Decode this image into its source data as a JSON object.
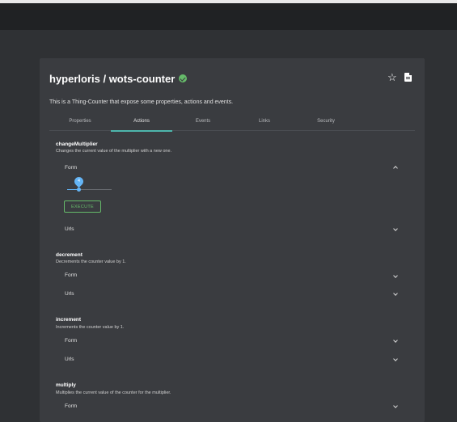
{
  "header": {
    "title": "hyperloris / wots-counter",
    "verified_icon": "check-circle-icon",
    "star_icon": "star-outline-icon",
    "doc_icon": "document-icon"
  },
  "description": "This is a Thing-Counter that expose some properties, actions and events.",
  "tabs": [
    {
      "label": "Properties",
      "active": false
    },
    {
      "label": "Actions",
      "active": true
    },
    {
      "label": "Events",
      "active": false
    },
    {
      "label": "Links",
      "active": false
    },
    {
      "label": "Security",
      "active": false
    }
  ],
  "actions": [
    {
      "name": "changeMultiplier",
      "description": "Changes the current value of the multiplier with a new one.",
      "form_label": "Form",
      "urls_label": "Urls",
      "slider_value": "4",
      "slider_fraction": 0.25,
      "execute_label": "EXECUTE"
    },
    {
      "name": "decrement",
      "description": "Decrements the counter value by 1.",
      "form_label": "Form",
      "urls_label": "Urls"
    },
    {
      "name": "increment",
      "description": "Increments the counter value by 1.",
      "form_label": "Form",
      "urls_label": "Urls"
    },
    {
      "name": "multiply",
      "description": "Multiplies the current value of the counter for the multiplier.",
      "form_label": "Form"
    }
  ],
  "colors": {
    "background": "#2f3134",
    "card": "#3a3c40",
    "accent_tab": "#4db6ac",
    "slider": "#64b5f6",
    "execute": "#66bb6a"
  }
}
